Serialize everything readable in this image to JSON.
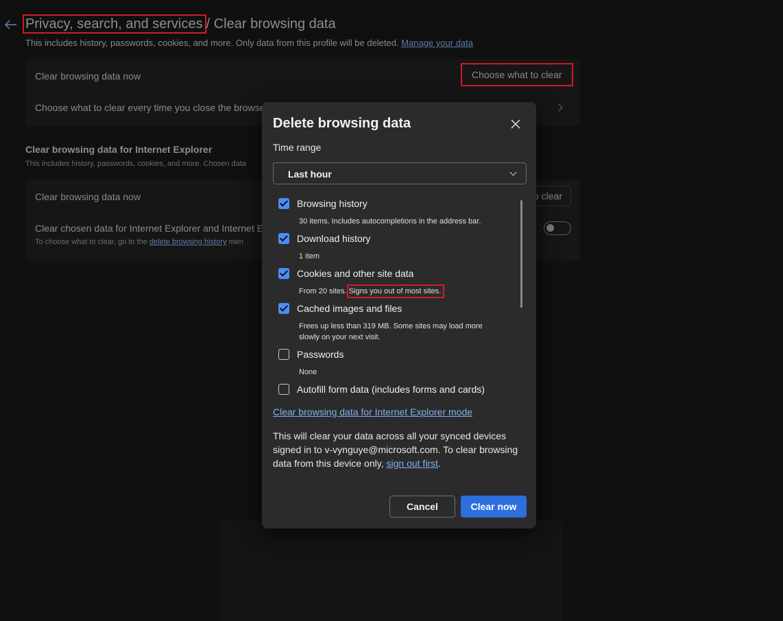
{
  "header": {
    "breadcrumb_parent": "Privacy, search, and services",
    "breadcrumb_current": "/ Clear browsing data",
    "subtitle": "This includes history, passwords, cookies, and more. Only data from this profile will be deleted.",
    "manage_link": "Manage your data"
  },
  "main_card": {
    "row1_label": "Clear browsing data now",
    "row1_button": "Choose what to clear",
    "row2_label": "Choose what to clear every time you close the browser"
  },
  "ie_section": {
    "title": "Clear browsing data for Internet Explorer",
    "subtitle": "This includes history, passwords, cookies, and more. Chosen data",
    "row1_label": "Clear browsing data now",
    "row1_button_partial": "o clear",
    "row2_label": "Clear chosen data for Internet Explorer and Internet Ex",
    "row2_desc_prefix": "To choose what to clear, go to the",
    "row2_desc_link": "delete browsing history",
    "row2_desc_suffix": "men"
  },
  "dialog": {
    "title": "Delete browsing data",
    "time_range_label": "Time range",
    "time_range_value": "Last hour",
    "options": [
      {
        "label": "Browsing history",
        "desc": "30 items. Includes autocompletions in the address bar.",
        "checked": true
      },
      {
        "label": "Download history",
        "desc": "1 item",
        "checked": true
      },
      {
        "label": "Cookies and other site data",
        "desc_prefix": "From 20 sites.",
        "desc_warning": "Signs you out of most sites.",
        "checked": true
      },
      {
        "label": "Cached images and files",
        "desc": "Frees up less than 319 MB. Some sites may load more slowly on your next visit.",
        "checked": true
      },
      {
        "label": "Passwords",
        "desc": "None",
        "checked": false
      },
      {
        "label": "Autofill form data (includes forms and cards)",
        "desc": "",
        "checked": false
      }
    ],
    "ie_mode_link": "Clear browsing data for Internet Explorer mode",
    "sync_note_prefix": "This will clear your data across all your synced devices signed in to v-vynguye@microsoft.com. To clear browsing data from this device only,",
    "sync_note_link": "sign out first",
    "sync_note_suffix": ".",
    "cancel_label": "Cancel",
    "clear_label": "Clear now"
  },
  "colors": {
    "accent": "#4c8df6",
    "primary_button": "#2d6fdc",
    "highlight": "#d21b26",
    "link": "#7fb1ef"
  }
}
